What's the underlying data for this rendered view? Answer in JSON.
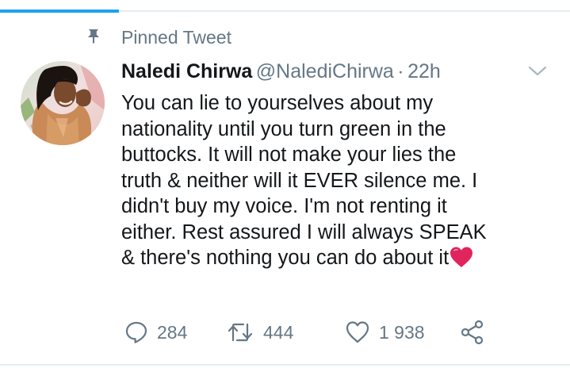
{
  "pinned": {
    "label": "Pinned Tweet",
    "icon": "pin-icon"
  },
  "tweet": {
    "author": {
      "display_name": "Naledi Chirwa",
      "handle": "@NalediChirwa",
      "separator": "·",
      "time": "22h"
    },
    "text": "You can lie to yourselves about my\nnationality until you turn green in the\nbuttocks. It will not make your lies the\ntruth & neither will it EVER silence me. I\ndidn't buy my voice. I'm not renting it\neither. Rest assured I will always SPEAK\n& there's nothing you can do about it",
    "emoji": "heart-emoji",
    "actions": {
      "replies": "284",
      "retweets": "444",
      "likes": "1 938"
    }
  },
  "colors": {
    "accent": "#1da1f2",
    "muted": "#657786",
    "text": "#14171a",
    "divider": "#e6ecf0",
    "heart": "#e0245e"
  }
}
